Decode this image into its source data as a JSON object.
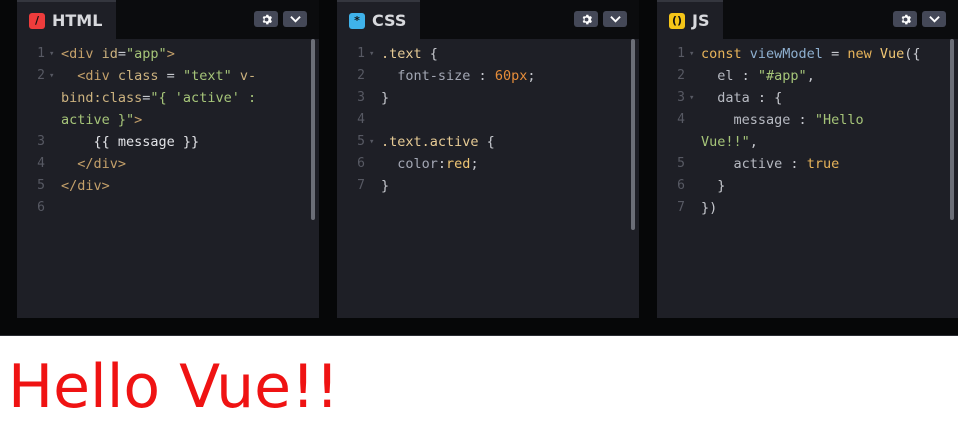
{
  "panels": {
    "html": {
      "tab_label": "HTML",
      "badge_icon": "/",
      "badge_color": "#ee3c3c",
      "lines": [
        {
          "n": "1",
          "fold": true,
          "segs": [
            [
              "t-tag",
              "<div "
            ],
            [
              "t-attr",
              "id"
            ],
            [
              "t-p",
              "="
            ],
            [
              "t-str",
              "\"app\""
            ],
            [
              "t-tag",
              ">"
            ]
          ]
        },
        {
          "n": "2",
          "fold": true,
          "segs": [
            [
              "t-p",
              "  "
            ],
            [
              "t-tag",
              "<div "
            ],
            [
              "t-attr",
              "class"
            ],
            [
              "t-p",
              " = "
            ],
            [
              "t-str",
              "\"text\""
            ],
            [
              "t-attr",
              " v-"
            ]
          ]
        },
        {
          "n": "",
          "fold": false,
          "segs": [
            [
              "t-attr",
              "bind:class"
            ],
            [
              "t-p",
              "="
            ],
            [
              "t-str",
              "\"{ 'active' :"
            ]
          ]
        },
        {
          "n": "",
          "fold": false,
          "segs": [
            [
              "t-str",
              "active }\""
            ],
            [
              "t-tag",
              ">"
            ]
          ]
        },
        {
          "n": "3",
          "fold": false,
          "segs": [
            [
              "t-txt",
              "    {{ message }}"
            ]
          ]
        },
        {
          "n": "4",
          "fold": false,
          "segs": [
            [
              "t-p",
              "  "
            ],
            [
              "t-tag",
              "</div>"
            ]
          ]
        },
        {
          "n": "5",
          "fold": false,
          "segs": [
            [
              "t-tag",
              "</div>"
            ]
          ]
        },
        {
          "n": "6",
          "fold": false,
          "segs": []
        }
      ]
    },
    "css": {
      "tab_label": "CSS",
      "badge_icon": "*",
      "badge_color": "#3fb2ea",
      "lines": [
        {
          "n": "1",
          "fold": true,
          "segs": [
            [
              "t-sel",
              ".text "
            ],
            [
              "t-p",
              "{"
            ]
          ]
        },
        {
          "n": "2",
          "fold": false,
          "segs": [
            [
              "t-p",
              "  "
            ],
            [
              "t-prop",
              "font-size"
            ],
            [
              "t-p",
              " : "
            ],
            [
              "t-num",
              "60px"
            ],
            [
              "t-p",
              ";"
            ]
          ]
        },
        {
          "n": "3",
          "fold": false,
          "segs": [
            [
              "t-p",
              "}"
            ]
          ]
        },
        {
          "n": "4",
          "fold": false,
          "segs": []
        },
        {
          "n": "5",
          "fold": true,
          "segs": [
            [
              "t-sel",
              ".text.active "
            ],
            [
              "t-p",
              "{"
            ]
          ]
        },
        {
          "n": "6",
          "fold": false,
          "segs": [
            [
              "t-p",
              "  "
            ],
            [
              "t-prop",
              "color"
            ],
            [
              "t-p",
              ":"
            ],
            [
              "t-val",
              "red"
            ],
            [
              "t-p",
              ";"
            ]
          ]
        },
        {
          "n": "7",
          "fold": false,
          "segs": [
            [
              "t-p",
              "}"
            ]
          ]
        }
      ]
    },
    "js": {
      "tab_label": "JS",
      "badge_icon": "()",
      "badge_color": "#f5c518",
      "lines": [
        {
          "n": "1",
          "fold": true,
          "segs": [
            [
              "t-kw",
              "const "
            ],
            [
              "t-var",
              "viewModel"
            ],
            [
              "t-p",
              " = "
            ],
            [
              "t-kw",
              "new "
            ],
            [
              "t-val",
              "Vue"
            ],
            [
              "t-p",
              "({"
            ]
          ]
        },
        {
          "n": "2",
          "fold": false,
          "segs": [
            [
              "t-p",
              "  "
            ],
            [
              "t-key",
              "el"
            ],
            [
              "t-p",
              " : "
            ],
            [
              "t-str",
              "\"#app\""
            ],
            [
              "t-p",
              ","
            ]
          ]
        },
        {
          "n": "3",
          "fold": true,
          "segs": [
            [
              "t-p",
              "  "
            ],
            [
              "t-key",
              "data"
            ],
            [
              "t-p",
              " : {"
            ]
          ]
        },
        {
          "n": "4",
          "fold": false,
          "segs": [
            [
              "t-p",
              "    "
            ],
            [
              "t-key",
              "message"
            ],
            [
              "t-p",
              " : "
            ],
            [
              "t-str",
              "\"Hello"
            ]
          ]
        },
        {
          "n": "",
          "fold": false,
          "segs": [
            [
              "t-str",
              "Vue!!\""
            ],
            [
              "t-p",
              ","
            ]
          ]
        },
        {
          "n": "5",
          "fold": false,
          "segs": [
            [
              "t-p",
              "    "
            ],
            [
              "t-key",
              "active"
            ],
            [
              "t-p",
              " : "
            ],
            [
              "t-kw",
              "true"
            ]
          ]
        },
        {
          "n": "6",
          "fold": false,
          "segs": [
            [
              "t-p",
              "  }"
            ]
          ]
        },
        {
          "n": "7",
          "fold": false,
          "segs": [
            [
              "t-p",
              "})"
            ]
          ]
        }
      ]
    }
  },
  "result": {
    "text": "Hello Vue!!",
    "color": "#ef1313"
  },
  "icons": {
    "settings": "gear-icon",
    "collapse": "chevron-down-icon",
    "fold": "fold-arrow-icon"
  }
}
